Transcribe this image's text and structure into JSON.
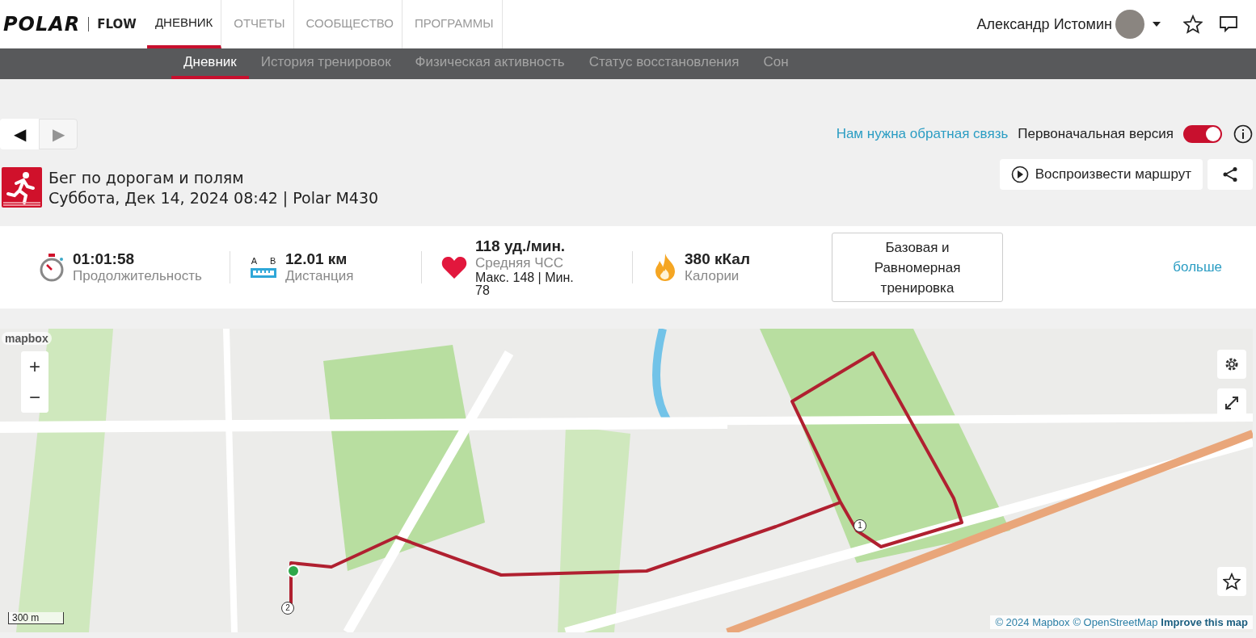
{
  "header": {
    "logo": "POLAR",
    "product": "FLOW",
    "nav": [
      {
        "label": "ДНЕВНИК",
        "selected": true
      },
      {
        "label": "ОТЧЕТЫ",
        "selected": false
      },
      {
        "label": "СООБЩЕСТВО",
        "selected": false
      },
      {
        "label": "ПРОГРАММЫ",
        "selected": false
      }
    ],
    "user": {
      "name": "Александр Истомин"
    }
  },
  "subnav": [
    {
      "label": "Дневник",
      "selected": true
    },
    {
      "label": "История тренировок",
      "selected": false
    },
    {
      "label": "Физическая активность",
      "selected": false
    },
    {
      "label": "Статус восстановления",
      "selected": false
    },
    {
      "label": "Сон",
      "selected": false
    }
  ],
  "pager": [
    {
      "symbol": "◀",
      "disabled": false
    },
    {
      "symbol": "▶",
      "disabled": true
    }
  ],
  "feedback_link": "Нам нужна обратная связь",
  "toggle": {
    "label": "Первоначальная версия",
    "on": true
  },
  "session": {
    "title": "Бег по дорогам и полям",
    "subtitle": "Суббота, Дек 14, 2024 08:42 | Polar M430"
  },
  "play_button": "Воспроизвести маршрут",
  "stats": [
    {
      "kind": "duration",
      "value": "01:01:58",
      "label": "Продолжительность"
    },
    {
      "kind": "distance",
      "value": "12.01 км",
      "label": "Дистанция",
      "marks": [
        "A",
        "B"
      ]
    },
    {
      "kind": "heart_rate",
      "value": "118 уд./мин.",
      "label": "Средняя ЧСС",
      "detail": "Макс. 148  |  Мин. 78"
    },
    {
      "kind": "calories",
      "value": "380 кКал",
      "label": "Калории"
    }
  ],
  "training_benefit": "Базовая и Равномерная тренировка",
  "more_link": "больше",
  "map": {
    "logo": "mapbox",
    "zoom_in": "+",
    "zoom_out": "−",
    "scale": "300 m",
    "route_markers": [
      "1",
      "2"
    ],
    "attribution": [
      {
        "text": "© 2024 Mapbox",
        "kind": "link"
      },
      {
        "text": "© OpenStreetMap",
        "kind": "link"
      },
      {
        "text": "Improve this map",
        "kind": "strong"
      }
    ]
  }
}
